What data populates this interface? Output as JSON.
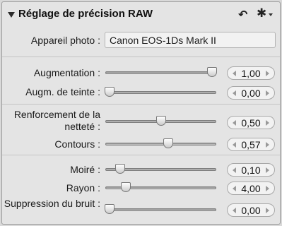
{
  "panel": {
    "title": "Réglage de précision RAW",
    "undo_icon": "undo-arrow-icon",
    "action_icon": "gear-icon"
  },
  "camera": {
    "label": "Appareil photo :",
    "value": "Canon EOS-1Ds Mark II"
  },
  "groups": [
    {
      "rows": [
        {
          "label": "Augmentation :",
          "value": "1,00",
          "level": 1.0
        },
        {
          "label": "Augm. de teinte :",
          "value": "0,00",
          "level": 0.0
        }
      ]
    },
    {
      "rows": [
        {
          "label": "Renforcement de la netteté :",
          "value": "0,50",
          "level": 0.5
        },
        {
          "label": "Contours :",
          "value": "0,57",
          "level": 0.57
        }
      ]
    },
    {
      "rows": [
        {
          "label": "Moiré :",
          "value": "0,10",
          "level": 0.1
        },
        {
          "label": "Rayon :",
          "value": "4,00",
          "level": 0.16
        },
        {
          "label": "Suppression du bruit :",
          "value": "0,00",
          "level": 0.0
        }
      ]
    }
  ]
}
